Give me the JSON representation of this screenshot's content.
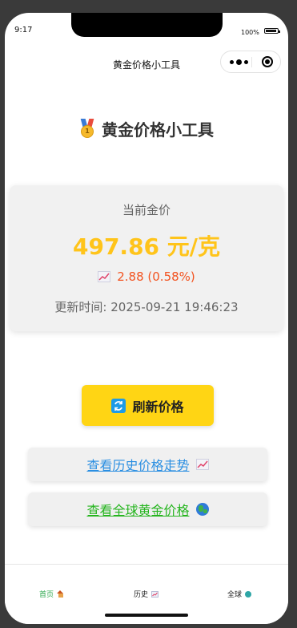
{
  "status_bar": {
    "time": "9:17",
    "battery": "100%"
  },
  "nav": {
    "title": "黄金价格小工具"
  },
  "header": {
    "title": "黄金价格小工具",
    "icon": "medal-icon"
  },
  "price_card": {
    "label": "当前金价",
    "value": "497.86 元/克",
    "change": "2.88 (0.58%)",
    "change_icon": "chart-up-icon",
    "update_time": "更新时间: 2025-09-21 19:46:23"
  },
  "actions": {
    "refresh_label": "刷新价格",
    "refresh_icon": "refresh-icon",
    "history_link": "查看历史价格走势",
    "global_link": "查看全球黄金价格"
  },
  "tabbar": {
    "items": [
      {
        "label": "首页",
        "icon": "house-icon",
        "active": true
      },
      {
        "label": "历史",
        "icon": "chart-up-icon",
        "active": false
      },
      {
        "label": "全球",
        "icon": "globe-icon",
        "active": false
      }
    ]
  },
  "colors": {
    "price": "#ffc41a",
    "change": "#f2521f",
    "refresh_button": "#ffd514",
    "history_link": "#2b8fe2",
    "global_link": "#26b51f",
    "active_tab": "#2fa84f"
  }
}
